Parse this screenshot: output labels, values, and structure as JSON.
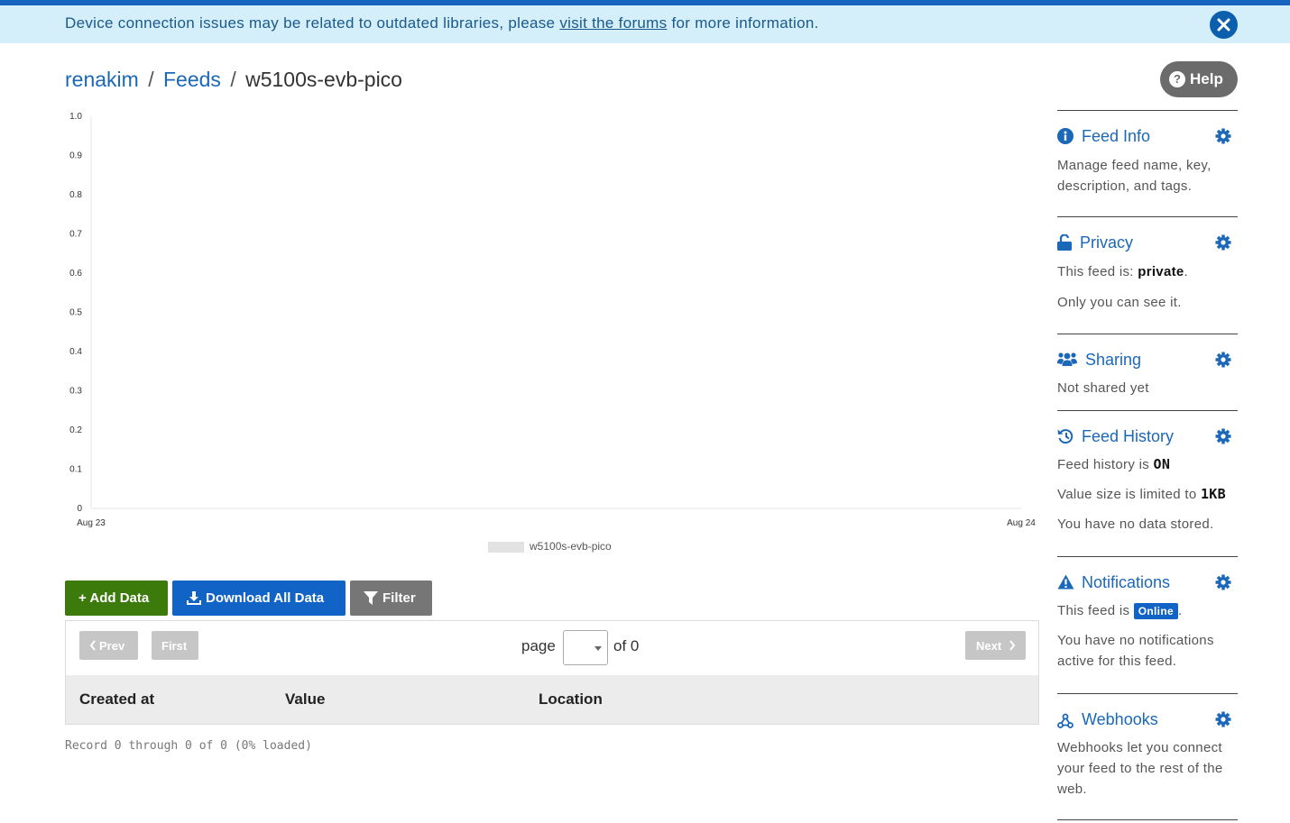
{
  "banner": {
    "text_before": "Device connection issues may be related to outdated libraries, please ",
    "link_text": "visit the forums",
    "text_after": " for more information."
  },
  "breadcrumb": {
    "user": "renakim",
    "feeds": "Feeds",
    "feed": "w5100s-evb-pico",
    "separator": "/"
  },
  "help": {
    "label": "Help",
    "icon": "question-circle-icon"
  },
  "chart_data": {
    "type": "line",
    "x_ticks": [
      "Aug 23",
      "Aug 24"
    ],
    "y_ticks": [
      "1.0",
      "0.9",
      "0.8",
      "0.7",
      "0.6",
      "0.5",
      "0.4",
      "0.3",
      "0.2",
      "0.1",
      "0"
    ],
    "ylim": [
      0,
      1.0
    ],
    "series": [
      {
        "name": "w5100s-evb-pico",
        "values": [],
        "color": "#e2e2e2"
      }
    ],
    "legend": "bottom-center",
    "grid": false
  },
  "actions": {
    "add": "+ Add Data",
    "download": "Download All Data",
    "filter": "Filter"
  },
  "pagination": {
    "prev": "Prev",
    "first": "First",
    "next": "Next",
    "page_label": "page",
    "of_label": "of 0"
  },
  "table": {
    "columns": [
      "Created at",
      "Value",
      "Location"
    ],
    "rows": []
  },
  "record_status": "Record 0 through 0 of 0 (0% loaded)",
  "colors": {
    "accent": "#1b67b8",
    "banner_bg": "#d4eefa",
    "add_button": "#3d7a0c",
    "download_button": "#1263c6",
    "filter_button": "#767676"
  },
  "sidebar": {
    "feed_info": {
      "title": "Feed Info",
      "text": "Manage feed name, key, description, and tags."
    },
    "privacy": {
      "title": "Privacy",
      "text_prefix": "This feed is: ",
      "status": "private",
      "text_suffix": ".",
      "note": "Only you can see it."
    },
    "sharing": {
      "title": "Sharing",
      "text": "Not shared yet"
    },
    "history": {
      "title": "Feed History",
      "history_prefix": "Feed history is ",
      "history_state": "ON",
      "size_prefix": "Value size is limited to ",
      "size_value": "1KB",
      "stored": "You have no data stored."
    },
    "notifications": {
      "title": "Notifications",
      "text_prefix": "This feed is ",
      "status_badge": "Online",
      "text_suffix": ".",
      "note": "You have no notifications active for this feed."
    },
    "webhooks": {
      "title": "Webhooks",
      "text": "Webhooks let you connect your feed to the rest of the web."
    }
  }
}
